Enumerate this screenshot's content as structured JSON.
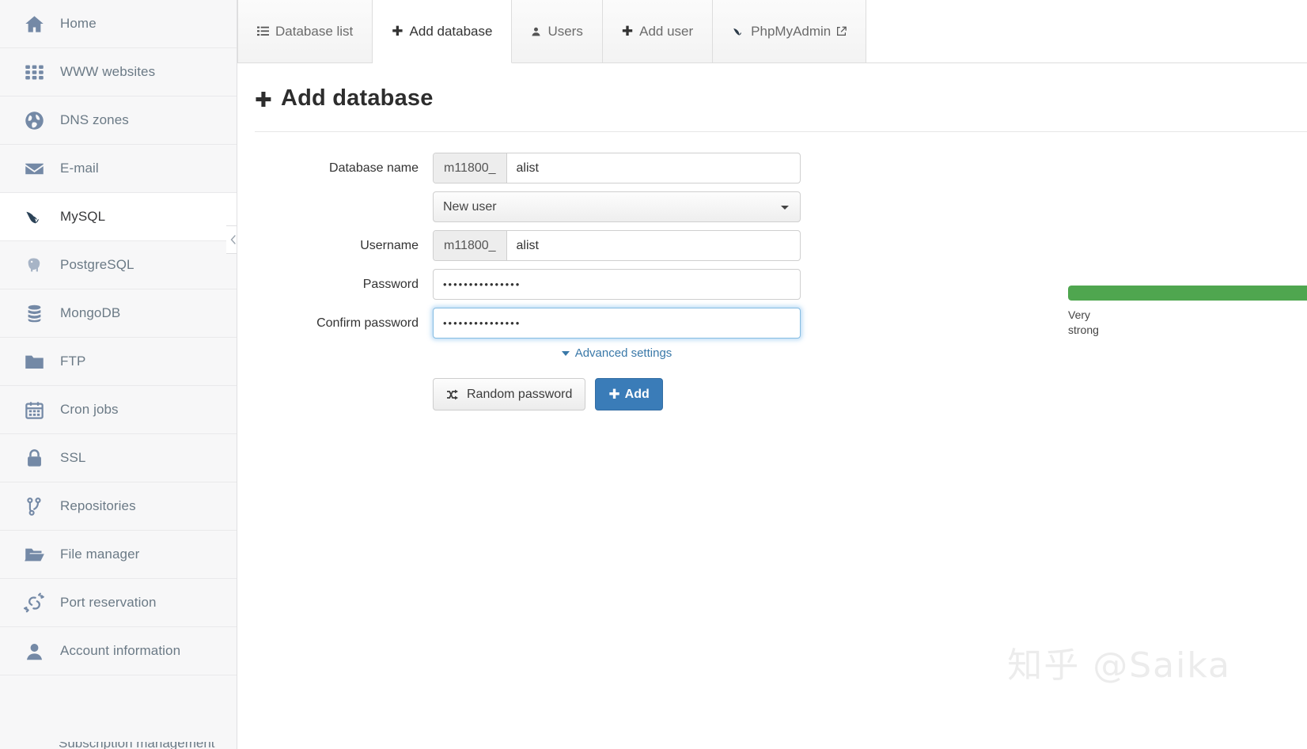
{
  "sidebar": {
    "items": [
      {
        "label": "Home",
        "icon": "home-icon",
        "active": false
      },
      {
        "label": "WWW websites",
        "icon": "grid-icon",
        "active": false
      },
      {
        "label": "DNS zones",
        "icon": "globe-icon",
        "active": false
      },
      {
        "label": "E-mail",
        "icon": "envelope-icon",
        "active": false
      },
      {
        "label": "MySQL",
        "icon": "dolphin-icon",
        "active": true
      },
      {
        "label": "PostgreSQL",
        "icon": "elephant-icon",
        "active": false
      },
      {
        "label": "MongoDB",
        "icon": "database-icon",
        "active": false
      },
      {
        "label": "FTP",
        "icon": "folder-icon",
        "active": false
      },
      {
        "label": "Cron jobs",
        "icon": "calendar-icon",
        "active": false
      },
      {
        "label": "SSL",
        "icon": "lock-icon",
        "active": false
      },
      {
        "label": "Repositories",
        "icon": "git-branch-icon",
        "active": false
      },
      {
        "label": "File manager",
        "icon": "folder-open-icon",
        "active": false
      },
      {
        "label": "Port reservation",
        "icon": "plug-icon",
        "active": false
      },
      {
        "label": "Account information",
        "icon": "user-icon",
        "active": false
      }
    ],
    "cutoff_label": "Subscription management"
  },
  "tabs": [
    {
      "label": "Database list",
      "icon": "list-icon",
      "active": false,
      "external": false
    },
    {
      "label": "Add database",
      "icon": "plus-icon",
      "active": true,
      "external": false
    },
    {
      "label": "Users",
      "icon": "user-icon",
      "active": false,
      "external": false
    },
    {
      "label": "Add user",
      "icon": "plus-icon",
      "active": false,
      "external": false
    },
    {
      "label": "PhpMyAdmin",
      "icon": "dolphin-icon",
      "active": false,
      "external": true
    }
  ],
  "page": {
    "title": "Add database",
    "title_icon": "plus-icon"
  },
  "form": {
    "database_name": {
      "label": "Database name",
      "prefix": "m11800_",
      "value": "alist",
      "placeholder": ""
    },
    "user_select": {
      "value": "New user",
      "options": [
        "New user"
      ]
    },
    "username": {
      "label": "Username",
      "prefix": "m11800_",
      "value": "alist",
      "placeholder": ""
    },
    "password": {
      "label": "Password",
      "value": "•••••••••••••••",
      "placeholder": ""
    },
    "confirm_password": {
      "label": "Confirm password",
      "value": "•••••••••••••••",
      "placeholder": "",
      "focused": true
    },
    "strength": {
      "text": "Very strong",
      "percent": 100,
      "color": "#4fa64f"
    },
    "advanced_settings_label": "Advanced settings"
  },
  "buttons": {
    "random_password": "Random password",
    "random_password_icon": "shuffle-icon",
    "add": "Add",
    "add_icon": "plus-icon",
    "add_color": "#3a7cb8"
  },
  "watermark": "知乎 @Saika"
}
